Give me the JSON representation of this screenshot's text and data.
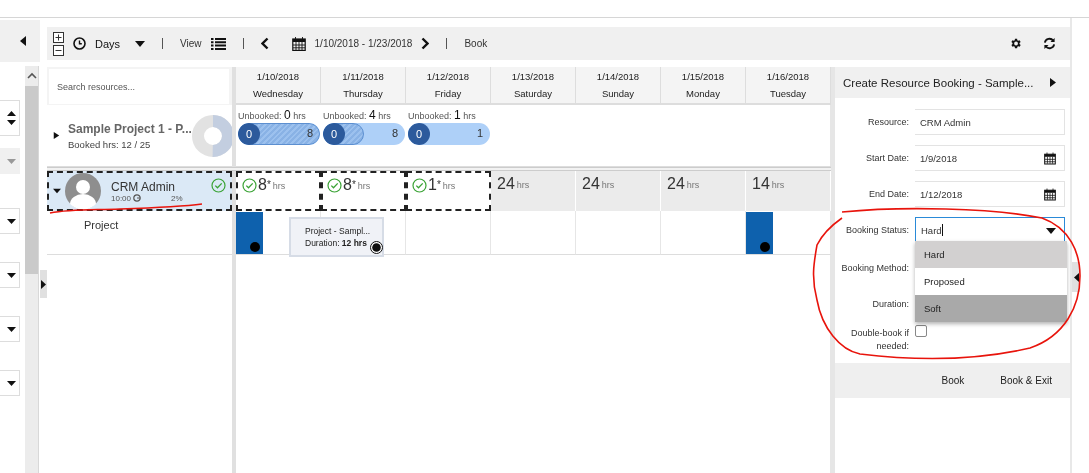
{
  "toolbar": {
    "view_unit": "Days",
    "view_label": "View",
    "date_range": "1/10/2018 - 1/23/2018",
    "book_button": "Book"
  },
  "resource_search": {
    "placeholder": "Search resources..."
  },
  "days": [
    {
      "date": "1/10/2018",
      "weekday": "Wednesday"
    },
    {
      "date": "1/11/2018",
      "weekday": "Thursday"
    },
    {
      "date": "1/12/2018",
      "weekday": "Friday"
    },
    {
      "date": "1/13/2018",
      "weekday": "Saturday"
    },
    {
      "date": "1/14/2018",
      "weekday": "Sunday"
    },
    {
      "date": "1/15/2018",
      "weekday": "Monday"
    },
    {
      "date": "1/16/2018",
      "weekday": "Tuesday"
    }
  ],
  "requirement": {
    "name": "Sample Project 1 - P...",
    "booked": "Booked hrs: 12 / 25",
    "expanded": false,
    "days": [
      {
        "label": "Unbooked:",
        "hours": "0",
        "unit": "hrs",
        "start": "0",
        "end": "8",
        "level": 1
      },
      {
        "label": "Unbooked:",
        "hours": "4",
        "unit": "hrs",
        "start": "0",
        "end": "8",
        "level": 0.5
      },
      {
        "label": "Unbooked:",
        "hours": "1",
        "unit": "hrs",
        "start": "0",
        "end": "1",
        "level": 0
      }
    ]
  },
  "resource": {
    "name": "CRM Admin",
    "time": "10:00",
    "utilization": "2%",
    "expanded": true,
    "selected": true,
    "cells": [
      {
        "hours": "8",
        "mark": "*",
        "unit": "hrs",
        "selected": true
      },
      {
        "hours": "8",
        "mark": "*",
        "unit": "hrs",
        "selected": true
      },
      {
        "hours": "1",
        "mark": "*",
        "unit": "hrs",
        "selected": true
      },
      {
        "hours": "24",
        "unit": "hrs",
        "selected": false
      },
      {
        "hours": "24",
        "unit": "hrs",
        "selected": false
      },
      {
        "hours": "24",
        "unit": "hrs",
        "selected": false
      },
      {
        "hours": "14",
        "unit": "hrs",
        "selected": false
      }
    ]
  },
  "booking_row": {
    "label": "Project",
    "cells": [
      {
        "booked": true
      },
      {
        "booked": false
      },
      {
        "booked": false
      },
      {
        "booked": false
      },
      {
        "booked": false
      },
      {
        "booked": false
      },
      {
        "booked": true
      }
    ],
    "card": {
      "title": "Project - Sampl...",
      "duration": "Duration: **12 hrs**"
    }
  },
  "panel": {
    "title": "Create Resource Booking - Sample...",
    "fields": [
      {
        "label": "Resource:",
        "kind": "text",
        "value": "CRM Admin"
      },
      {
        "label": "Start Date:",
        "kind": "date",
        "value": "1/9/2018"
      },
      {
        "label": "End Date:",
        "kind": "date",
        "value": "1/12/2018"
      },
      {
        "label": "Booking Status:",
        "kind": "select",
        "value": "Hard",
        "focused": true
      },
      {
        "label": "Booking Method:",
        "kind": "covered"
      },
      {
        "label": "Duration:",
        "kind": "covered"
      },
      {
        "label": "Double-book if needed:",
        "kind": "checkbox",
        "checked": false
      }
    ],
    "dropdown": {
      "options": [
        {
          "label": "Hard",
          "selected": true,
          "hovered": false
        },
        {
          "label": "Proposed",
          "selected": false,
          "hovered": false
        },
        {
          "label": "Soft",
          "selected": false,
          "hovered": true
        }
      ]
    },
    "buttons": [
      "Book",
      "Book & Exit"
    ]
  }
}
